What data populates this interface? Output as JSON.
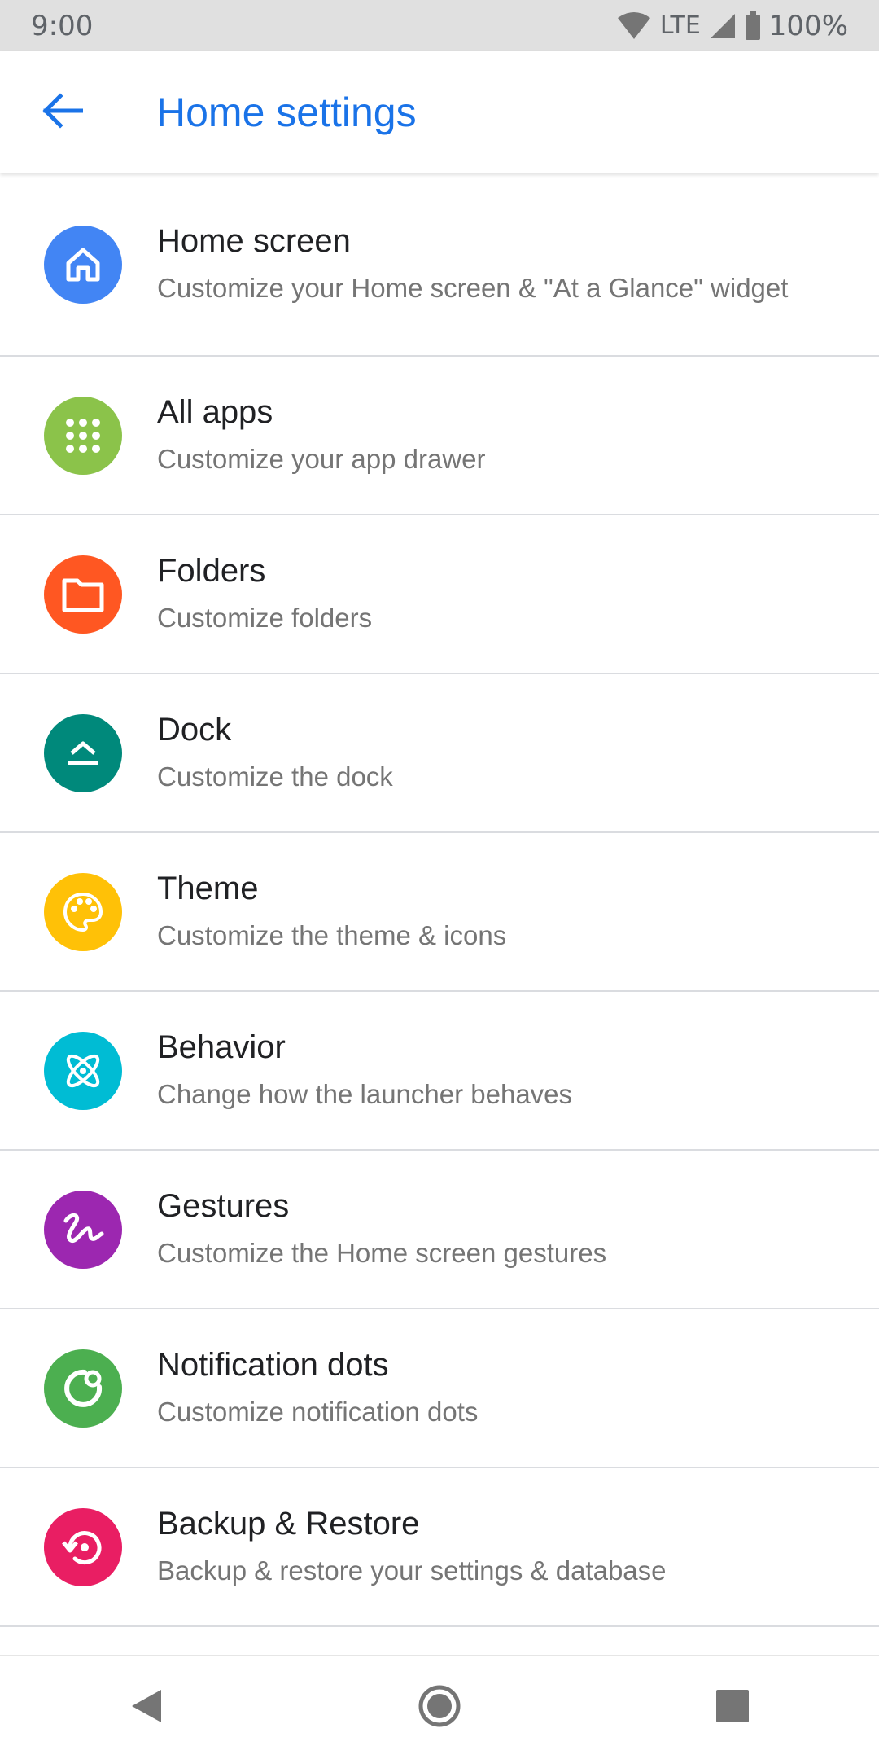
{
  "status_bar": {
    "time": "9:00",
    "network": "LTE",
    "battery": "100%",
    "icons": [
      "wifi-icon",
      "signal-icon",
      "battery-icon"
    ]
  },
  "app_bar": {
    "title": "Home settings",
    "back_icon": "arrow-back-icon",
    "accent_color": "#1a73e8"
  },
  "settings": [
    {
      "title": "Home screen",
      "subtitle": "Customize your Home screen & \"At a Glance\" widget",
      "icon": "home-icon",
      "color": "#4285f4"
    },
    {
      "title": "All apps",
      "subtitle": "Customize your app drawer",
      "icon": "apps-grid-icon",
      "color": "#8bc34a"
    },
    {
      "title": "Folders",
      "subtitle": "Customize folders",
      "icon": "folder-icon",
      "color": "#ff5722"
    },
    {
      "title": "Dock",
      "subtitle": "Customize the dock",
      "icon": "dock-icon",
      "color": "#00897b"
    },
    {
      "title": "Theme",
      "subtitle": "Customize the theme & icons",
      "icon": "palette-icon",
      "color": "#ffc107"
    },
    {
      "title": "Behavior",
      "subtitle": "Change how the launcher behaves",
      "icon": "atom-icon",
      "color": "#00bcd4"
    },
    {
      "title": "Gestures",
      "subtitle": "Customize the Home screen gestures",
      "icon": "gesture-icon",
      "color": "#9c27b0"
    },
    {
      "title": "Notification dots",
      "subtitle": "Customize notification dots",
      "icon": "notification-dot-icon",
      "color": "#4caf50"
    },
    {
      "title": "Backup & Restore",
      "subtitle": "Backup & restore your settings & database",
      "icon": "backup-restore-icon",
      "color": "#e91e63"
    }
  ],
  "nav_bar": {
    "icons": [
      "back-triangle-icon",
      "home-circle-icon",
      "recents-square-icon"
    ]
  }
}
